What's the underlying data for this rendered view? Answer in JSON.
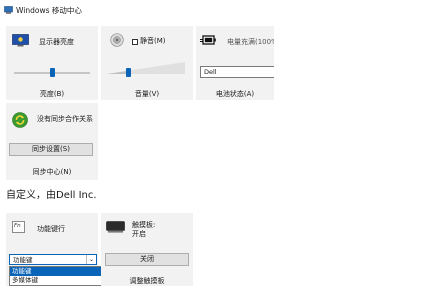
{
  "window": {
    "title": "Windows 移动中心",
    "icon": "mobility-center-icon"
  },
  "tiles": {
    "brightness": {
      "label": "显示器亮度",
      "footer": "亮度(B)",
      "level": 0.5,
      "icon": "monitor-brightness-icon"
    },
    "volume": {
      "mute_label": "静音(M)",
      "muted": false,
      "footer": "音量(V)",
      "level": 0.27,
      "icon": "speaker-icon"
    },
    "battery": {
      "label": "电量充满(100%",
      "plan_value": "Dell",
      "footer": "电池状态(A)",
      "icon": "battery-plug-icon"
    },
    "sync": {
      "label": "没有同步合作关系",
      "button": "同步设置(S)",
      "footer": "同步中心(N)",
      "icon": "sync-arrows-icon"
    }
  },
  "custom_section": {
    "heading": "自定义，由Dell Inc."
  },
  "custom_tiles": {
    "fn_key": {
      "label": "功能键行",
      "icon_text": "Fn",
      "selected_value": "功能键",
      "options": [
        "功能键",
        "多媒体键"
      ],
      "selected_index": 0,
      "icon": "fn-key-icon"
    },
    "touchpad": {
      "label_line1": "触摸板:",
      "label_line2": "开启",
      "button": "关闭",
      "footer": "调整触摸板",
      "icon": "touchpad-icon"
    }
  },
  "colors": {
    "tile_bg": "#f2f2f2",
    "accent": "#0a64b8",
    "button_bg": "#e1e1e1"
  }
}
